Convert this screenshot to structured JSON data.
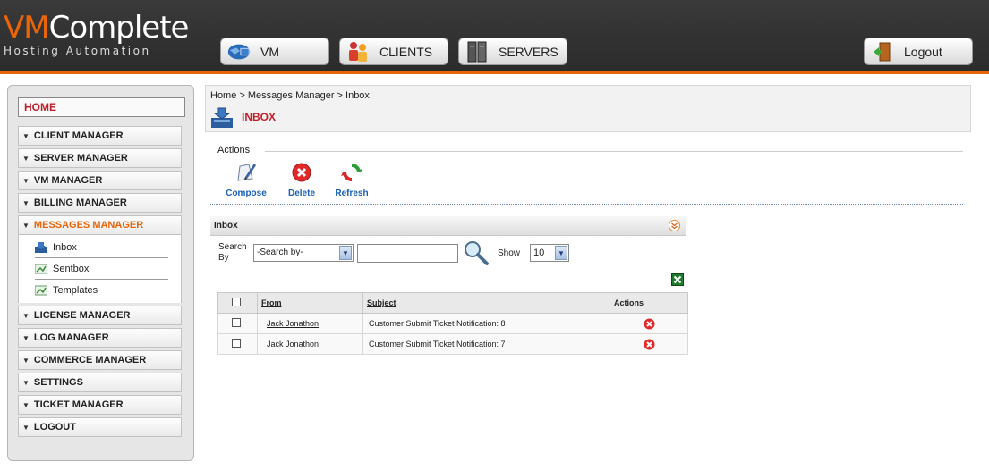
{
  "brand": {
    "vm": "VM",
    "complete": "Complete",
    "tagline": "Hosting Automation"
  },
  "topnav": {
    "vm_label": "VM",
    "clients_label": "CLIENTS",
    "servers_label": "SERVERS",
    "logout_label": "Logout"
  },
  "sidebar": {
    "home": "HOME",
    "items": [
      {
        "label": "CLIENT MANAGER"
      },
      {
        "label": "SERVER MANAGER"
      },
      {
        "label": "VM MANAGER"
      },
      {
        "label": "BILLING MANAGER"
      },
      {
        "label": "MESSAGES MANAGER"
      },
      {
        "label": "LICENSE MANAGER"
      },
      {
        "label": "LOG MANAGER"
      },
      {
        "label": "COMMERCE MANAGER"
      },
      {
        "label": "SETTINGS"
      },
      {
        "label": "TICKET MANAGER"
      },
      {
        "label": "LOGOUT"
      }
    ],
    "messages_sub": [
      {
        "label": "Inbox"
      },
      {
        "label": "Sentbox"
      },
      {
        "label": "Templates"
      }
    ]
  },
  "main": {
    "breadcrumb": "Home > Messages Manager > Inbox",
    "title": "INBOX",
    "actions_label": "Actions",
    "actions": {
      "compose": "Compose",
      "delete": "Delete",
      "refresh": "Refresh"
    },
    "panel_title": "Inbox",
    "search": {
      "label_line1": "Search",
      "label_line2": "By",
      "select_value": "-Search by-",
      "input_value": "",
      "show_label": "Show",
      "show_value": "10"
    },
    "table": {
      "headers": {
        "from": "From",
        "subject": "Subject",
        "actions": "Actions"
      },
      "rows": [
        {
          "from": "Jack Jonathon",
          "subject": "Customer Submit Ticket Notification: 8"
        },
        {
          "from": "Jack Jonathon",
          "subject": "Customer Submit Ticket Notification: 7"
        }
      ]
    }
  },
  "colors": {
    "accent": "#e8650a",
    "title_red": "#c0202a",
    "link_blue": "#1a5fb4",
    "header_bg": "#2f2f2f"
  }
}
